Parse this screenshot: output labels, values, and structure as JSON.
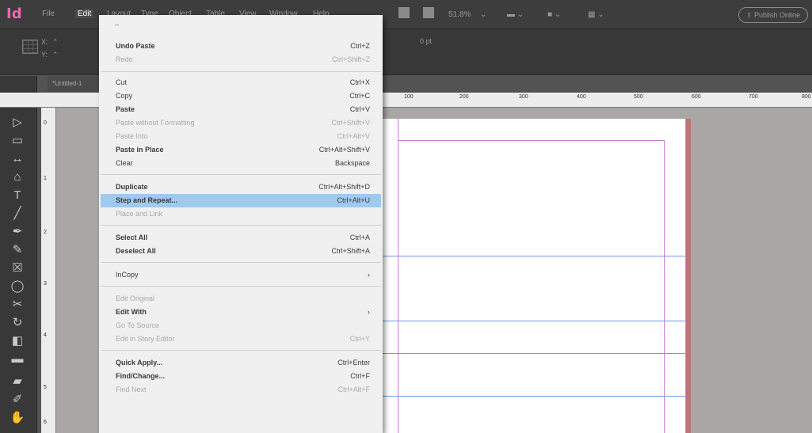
{
  "app": {
    "logo": "Id"
  },
  "menubar": {
    "items": [
      "File",
      "Edit",
      "Layout",
      "Type",
      "Object",
      "Table",
      "View",
      "Window",
      "Help"
    ],
    "zoom": "51.8%",
    "publish": "Publish Online"
  },
  "controlbar": {
    "x_label": "X:",
    "y_label": "Y:",
    "stroke_weight": "0 pt"
  },
  "doc_tab": {
    "label": "*Untitled-1"
  },
  "ruler": {
    "h_ticks": [
      "100",
      "200",
      "300",
      "400",
      "500",
      "600",
      "700",
      "800"
    ],
    "v_ticks": [
      "0",
      "1",
      "2",
      "3",
      "4",
      "5",
      "6"
    ]
  },
  "edit_menu": {
    "items": [
      {
        "label": "Undo Paste",
        "shortcut": "Ctrl+Z",
        "enabled": true
      },
      {
        "label": "Redo",
        "shortcut": "Ctrl+Shift+Z",
        "enabled": false
      },
      {
        "label": "Cut",
        "shortcut": "Ctrl+X",
        "enabled": true
      },
      {
        "label": "Copy",
        "shortcut": "Ctrl+C",
        "enabled": true
      },
      {
        "label": "Paste",
        "shortcut": "Ctrl+V",
        "enabled": true
      },
      {
        "label": "Paste without Formatting",
        "shortcut": "Ctrl+Shift+V",
        "enabled": false
      },
      {
        "label": "Paste Into",
        "shortcut": "Ctrl+Alt+V",
        "enabled": false
      },
      {
        "label": "Paste in Place",
        "shortcut": "Ctrl+Alt+Shift+V",
        "enabled": true
      },
      {
        "label": "Clear",
        "shortcut": "Backspace",
        "enabled": true
      },
      {
        "label": "Duplicate",
        "shortcut": "Ctrl+Alt+Shift+D",
        "enabled": true
      },
      {
        "label": "Step and Repeat...",
        "shortcut": "Ctrl+Alt+U",
        "enabled": true,
        "highlighted": true
      },
      {
        "label": "Place and Link",
        "shortcut": "",
        "enabled": false
      },
      {
        "label": "Select All",
        "shortcut": "Ctrl+A",
        "enabled": true
      },
      {
        "label": "Deselect All",
        "shortcut": "Ctrl+Shift+A",
        "enabled": true
      },
      {
        "label": "InCopy",
        "shortcut": "",
        "enabled": true,
        "submenu": true
      },
      {
        "label": "Edit Original",
        "shortcut": "",
        "enabled": false
      },
      {
        "label": "Edit With",
        "shortcut": "",
        "enabled": true,
        "submenu": true
      },
      {
        "label": "Go To Source",
        "shortcut": "",
        "enabled": false
      },
      {
        "label": "Edit in Story Editor",
        "shortcut": "Ctrl+Y",
        "enabled": false
      },
      {
        "label": "Quick Apply...",
        "shortcut": "Ctrl+Enter",
        "enabled": true
      },
      {
        "label": "Find/Change...",
        "shortcut": "Ctrl+F",
        "enabled": true
      },
      {
        "label": "Find Next",
        "shortcut": "Ctrl+Alt+F",
        "enabled": false
      }
    ]
  }
}
